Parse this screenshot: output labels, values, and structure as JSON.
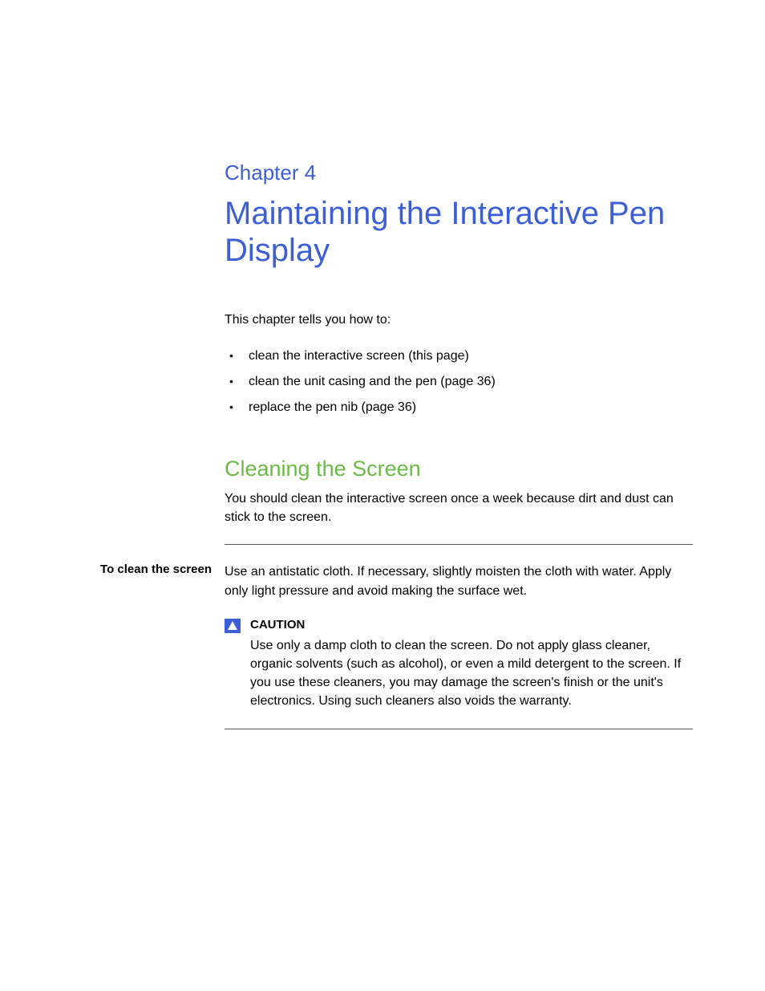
{
  "chapter": {
    "label": "Chapter 4",
    "title": "Maintaining the Interactive Pen Display"
  },
  "intro": "This chapter tells you how to:",
  "bullets": [
    "clean the interactive screen (this page)",
    "clean the unit casing and the pen (page 36)",
    "replace the pen nib (page 36)"
  ],
  "section": {
    "heading": "Cleaning the Screen",
    "text": "You should clean the interactive screen once a week because dirt and dust can stick to the screen."
  },
  "procedure": {
    "label": "To clean the screen",
    "text": "Use an antistatic cloth. If necessary, slightly moisten the cloth with water. Apply only light pressure and avoid making the surface wet."
  },
  "caution": {
    "label": "CAUTION",
    "text": "Use only a damp cloth to clean the screen. Do not apply glass cleaner, organic solvents (such as alcohol), or even a mild detergent to the screen. If you use these cleaners, you may damage the screen's finish or the unit's electronics. Using such cleaners also voids the warranty."
  }
}
